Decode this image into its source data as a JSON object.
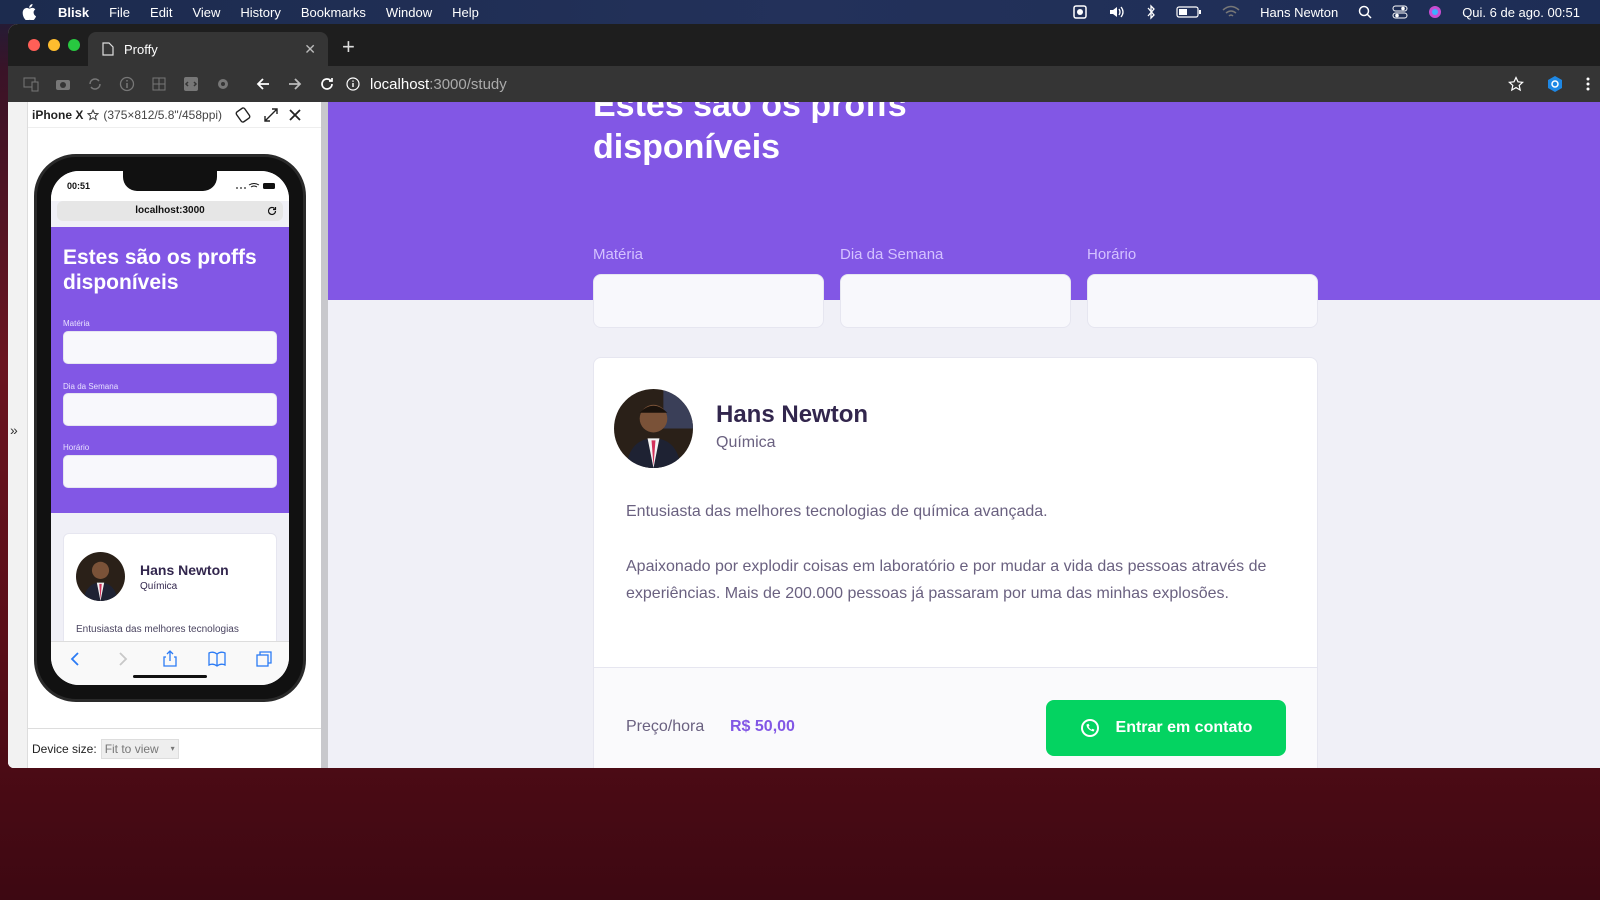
{
  "menubar": {
    "app": "Blisk",
    "items": [
      "File",
      "Edit",
      "View",
      "History",
      "Bookmarks",
      "Window",
      "Help"
    ],
    "user": "Hans Newton",
    "clock": "Qui. 6 de ago.  00:51"
  },
  "browser": {
    "tab_title": "Proffy",
    "url_host": "localhost",
    "url_path": ":3000/study"
  },
  "device": {
    "name": "iPhone X",
    "spec": "(375×812/5.8\"/458ppi)",
    "size_label": "Device size:",
    "size_value": "Fit to view",
    "status_time": "00:51",
    "address": "localhost:3000"
  },
  "page": {
    "title": "Estes são os proffs disponíveis",
    "filters": {
      "subject_label": "Matéria",
      "weekday_label": "Dia da Semana",
      "time_label": "Horário"
    },
    "teacher": {
      "name": "Hans Newton",
      "subject": "Química",
      "bio_1": "Entusiasta das melhores tecnologias de química avançada.",
      "bio_2": "Apaixonado por explodir coisas em laboratório e por mudar a vida das pessoas através de experiências. Mais de 200.000 pessoas já passaram por uma das minhas explosões.",
      "bio_mobile": "Entusiasta das melhores tecnologias",
      "price_label": "Preço/hora",
      "price_value": "R$ 50,00",
      "contact_button": "Entrar em contato"
    }
  },
  "colors": {
    "primary": "#8257e5",
    "whatsapp_green": "#04d361",
    "text_title": "#32264d"
  }
}
